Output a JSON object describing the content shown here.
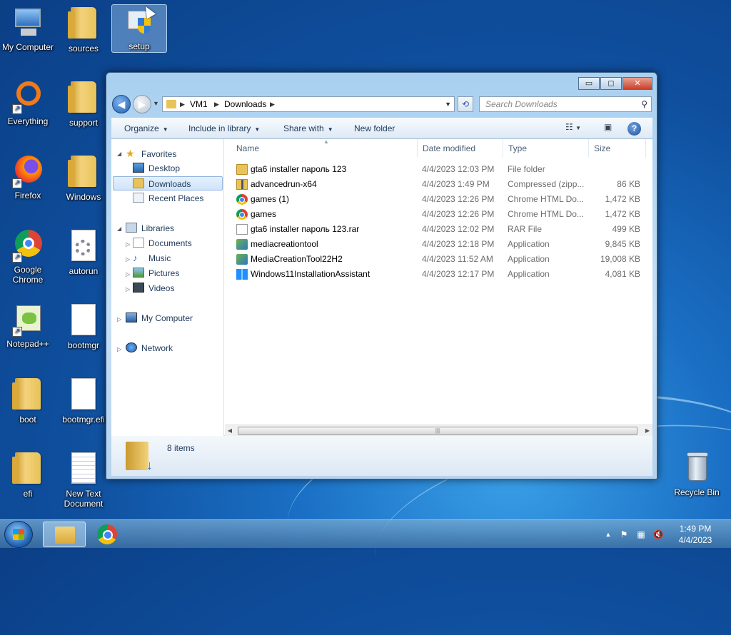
{
  "desktop": {
    "icons": [
      {
        "label": "My Computer"
      },
      {
        "label": "sources"
      },
      {
        "label": "setup"
      },
      {
        "label": "Everything"
      },
      {
        "label": "support"
      },
      {
        "label": "Firefox"
      },
      {
        "label": "Windows"
      },
      {
        "label": "Google Chrome"
      },
      {
        "label": "autorun"
      },
      {
        "label": "Notepad++"
      },
      {
        "label": "bootmgr"
      },
      {
        "label": "boot"
      },
      {
        "label": "bootmgr.efi"
      },
      {
        "label": "efi"
      },
      {
        "label": "New Text Document"
      },
      {
        "label": "Recycle Bin"
      }
    ]
  },
  "window": {
    "controls": {
      "minimize": "▭",
      "maximize": "◻",
      "close": "✕"
    },
    "address": {
      "crumbs": [
        "VM1",
        "Downloads"
      ]
    },
    "search": {
      "placeholder": "Search Downloads"
    },
    "toolbar": {
      "organize": "Organize",
      "include_in_library": "Include in library",
      "share_with": "Share with",
      "new_folder": "New folder"
    },
    "nav": {
      "favorites": "Favorites",
      "desktop": "Desktop",
      "downloads": "Downloads",
      "recent_places": "Recent Places",
      "libraries": "Libraries",
      "documents": "Documents",
      "music": "Music",
      "pictures": "Pictures",
      "videos": "Videos",
      "my_computer": "My Computer",
      "network": "Network"
    },
    "columns": {
      "name": "Name",
      "date": "Date modified",
      "type": "Type",
      "size": "Size"
    },
    "files": [
      {
        "name": "gta6 installer пароль 123",
        "date": "4/4/2023 12:03 PM",
        "type": "File folder",
        "size": "",
        "icon": "folder-icon"
      },
      {
        "name": "advancedrun-x64",
        "date": "4/4/2023 1:49 PM",
        "type": "Compressed (zipp...",
        "size": "86 KB",
        "icon": "zip-folder-icon"
      },
      {
        "name": "games (1)",
        "date": "4/4/2023 12:26 PM",
        "type": "Chrome HTML Do...",
        "size": "1,472 KB",
        "icon": "chrome-icon"
      },
      {
        "name": "games",
        "date": "4/4/2023 12:26 PM",
        "type": "Chrome HTML Do...",
        "size": "1,472 KB",
        "icon": "chrome-icon"
      },
      {
        "name": "gta6 installer пароль 123.rar",
        "date": "4/4/2023 12:02 PM",
        "type": "RAR File",
        "size": "499 KB",
        "icon": "rar-file-icon"
      },
      {
        "name": "mediacreationtool",
        "date": "4/4/2023 12:18 PM",
        "type": "Application",
        "size": "9,845 KB",
        "icon": "application-icon"
      },
      {
        "name": "MediaCreationTool22H2",
        "date": "4/4/2023 11:52 AM",
        "type": "Application",
        "size": "19,008 KB",
        "icon": "application-icon"
      },
      {
        "name": "Windows11InstallationAssistant",
        "date": "4/4/2023 12:17 PM",
        "type": "Application",
        "size": "4,081 KB",
        "icon": "windows-logo-icon"
      }
    ],
    "status": {
      "item_count": "8 items"
    }
  },
  "taskbar": {
    "clock_time": "1:49 PM",
    "clock_date": "4/4/2023"
  }
}
